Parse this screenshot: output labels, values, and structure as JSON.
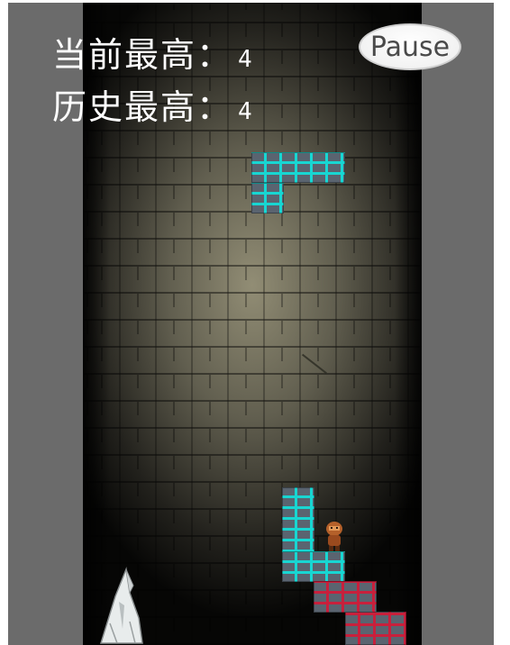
{
  "hud": {
    "current_label": "当前最高：",
    "current_value": "4",
    "best_label": "历史最高：",
    "best_value": "4"
  },
  "controls": {
    "pause_label": "Pause"
  },
  "colors": {
    "frame": "#6b6b6b",
    "block_cyan": "#18d6d2",
    "block_red": "#c8203c",
    "block_base": "#5a6470"
  },
  "sprites": {
    "player": "hero-character-icon",
    "enemy": "ghost-monster-icon"
  }
}
